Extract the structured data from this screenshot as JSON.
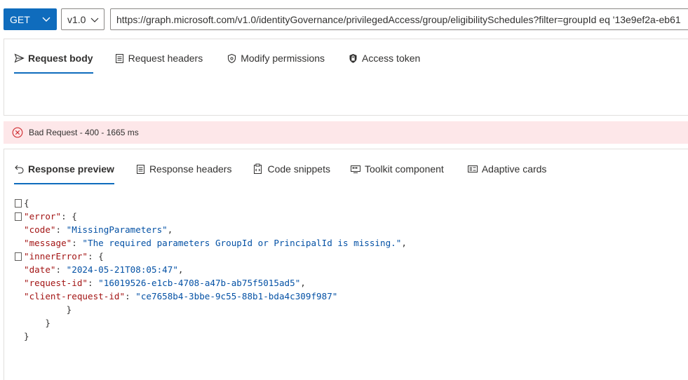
{
  "request": {
    "method": "GET",
    "version": "v1.0",
    "url": "https://graph.microsoft.com/v1.0/identityGovernance/privilegedAccess/group/eligibilitySchedules?filter=groupId eq '13e9ef2a-eb61"
  },
  "request_tabs": [
    {
      "label": "Request body",
      "icon": "send-icon"
    },
    {
      "label": "Request headers",
      "icon": "document-icon"
    },
    {
      "label": "Modify permissions",
      "icon": "shield-icon"
    },
    {
      "label": "Access token",
      "icon": "lock-icon"
    }
  ],
  "status": {
    "text": "Bad Request - 400 - 1665 ms",
    "icon": "error-circle-icon",
    "color": "#d13438",
    "background": "#fde7e9"
  },
  "response_tabs": [
    {
      "label": "Response preview",
      "icon": "undo-arrow-icon"
    },
    {
      "label": "Response headers",
      "icon": "document-icon"
    },
    {
      "label": "Code snippets",
      "icon": "clipboard-code-icon"
    },
    {
      "label": "Toolkit component",
      "icon": "toolkit-icon"
    },
    {
      "label": "Adaptive cards",
      "icon": "card-icon"
    }
  ],
  "response": {
    "error_key": "\"error\"",
    "code_key": "\"code\"",
    "code_value": "\"MissingParameters\"",
    "message_key": "\"message\"",
    "message_value": "\"The required parameters GroupId or PrincipalId is missing.\"",
    "innerError_key": "\"innerError\"",
    "date_key": "\"date\"",
    "date_value": "\"2024-05-21T08:05:47\"",
    "request_id_key": "\"request-id\"",
    "request_id_value": "\"16019526-e1cb-4708-a47b-ab75f5015ad5\"",
    "client_request_id_key": "\"client-request-id\"",
    "client_request_id_value": "\"ce7658b4-3bbe-9c55-88b1-bda4c309f987\""
  },
  "colors": {
    "accent": "#0f6cbd",
    "json_key": "#a31515",
    "json_string": "#0451a5"
  }
}
